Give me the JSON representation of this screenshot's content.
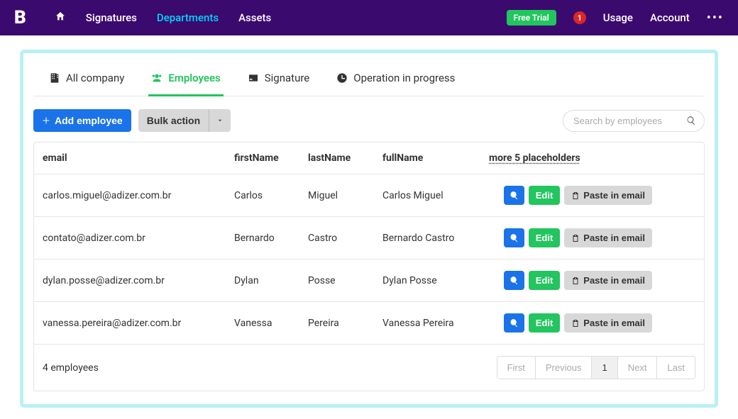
{
  "header": {
    "logo": "B",
    "nav": [
      {
        "type": "home",
        "label": ""
      },
      {
        "type": "link",
        "label": "Signatures"
      },
      {
        "type": "link",
        "label": "Departments",
        "active": true
      },
      {
        "type": "link",
        "label": "Assets"
      }
    ],
    "freeTrial": "Free Trial",
    "badge": "1",
    "usage": "Usage",
    "account": "Account"
  },
  "tabs": {
    "allCompany": "All company",
    "employees": "Employees",
    "signature": "Signature",
    "operation": "Operation in progress"
  },
  "actions": {
    "addEmployee": "Add employee",
    "bulkAction": "Bulk action",
    "searchPlaceholder": "Search by employees"
  },
  "table": {
    "columns": {
      "email": "email",
      "firstName": "firstName",
      "lastName": "lastName",
      "fullName": "fullName",
      "more": "more 5 placeholders"
    },
    "rows": [
      {
        "email": "carlos.miguel@adizer.com.br",
        "firstName": "Carlos",
        "lastName": "Miguel",
        "fullName": "Carlos Miguel"
      },
      {
        "email": "contato@adizer.com.br",
        "firstName": "Bernardo",
        "lastName": "Castro",
        "fullName": "Bernardo Castro"
      },
      {
        "email": "dylan.posse@adizer.com.br",
        "firstName": "Dylan",
        "lastName": "Posse",
        "fullName": "Dylan Posse"
      },
      {
        "email": "vanessa.pereira@adizer.com.br",
        "firstName": "Vanessa",
        "lastName": "Pereira",
        "fullName": "Vanessa Pereira"
      }
    ],
    "rowActions": {
      "edit": "Edit",
      "paste": "Paste in email"
    },
    "count": "4 employees",
    "pagination": {
      "first": "First",
      "previous": "Previous",
      "current": "1",
      "next": "Next",
      "last": "Last"
    }
  }
}
